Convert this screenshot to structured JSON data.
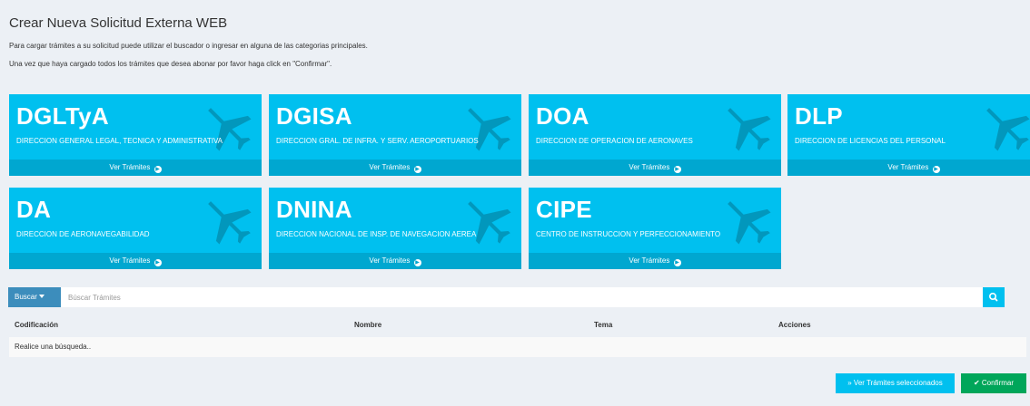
{
  "page": {
    "title": "Crear Nueva Solicitud Externa WEB",
    "intro_1": "Para cargar trámites a su solicitud puede utilizar el buscador o ingresar en alguna de las categorias principales.",
    "intro_2": "Una vez que haya cargado todos los trámites que desea abonar por favor haga click en \"Confirmar\"."
  },
  "colors": {
    "tile_bg": "#00c0ef",
    "tile_footer_bg": "#00a7d0",
    "search_button": "#3c8dbc",
    "confirm_button": "#00a65a"
  },
  "tiles": [
    {
      "code": "DGLTyA",
      "desc": "DIRECCION GENERAL LEGAL, TECNICA Y ADMINISTRATIVA",
      "link": "Ver Trámites",
      "icon": "plane-icon"
    },
    {
      "code": "DGISA",
      "desc": "DIRECCION GRAL. DE INFRA. Y SERV. AEROPORTUARIOS",
      "link": "Ver Trámites",
      "icon": "plane-icon"
    },
    {
      "code": "DOA",
      "desc": "DIRECCION DE OPERACION DE AERONAVES",
      "link": "Ver Trámites",
      "icon": "plane-icon"
    },
    {
      "code": "DLP",
      "desc": "DIRECCION DE LICENCIAS DEL PERSONAL",
      "link": "Ver Trámites",
      "icon": "plane-icon"
    },
    {
      "code": "DA",
      "desc": "DIRECCION DE AERONAVEGABILIDAD",
      "link": "Ver Trámites",
      "icon": "plane-icon"
    },
    {
      "code": "DNINA",
      "desc": "DIRECCION NACIONAL DE INSP. DE NAVEGACION AEREA",
      "link": "Ver Trámites",
      "icon": "plane-icon"
    },
    {
      "code": "CIPE",
      "desc": "CENTRO DE INSTRUCCION Y PERFECCIONAMIENTO",
      "link": "Ver Trámites",
      "icon": "plane-icon"
    }
  ],
  "search": {
    "button_label": "Buscar",
    "placeholder": "Búscar Trámites",
    "value": ""
  },
  "table": {
    "columns": [
      "Codificación",
      "Nombre",
      "Tema",
      "Acciones"
    ],
    "empty_text": "Realice una búsqueda.."
  },
  "actions": {
    "view_selected": "Ver Trámites seleccionados",
    "confirm": "Confirmar"
  }
}
